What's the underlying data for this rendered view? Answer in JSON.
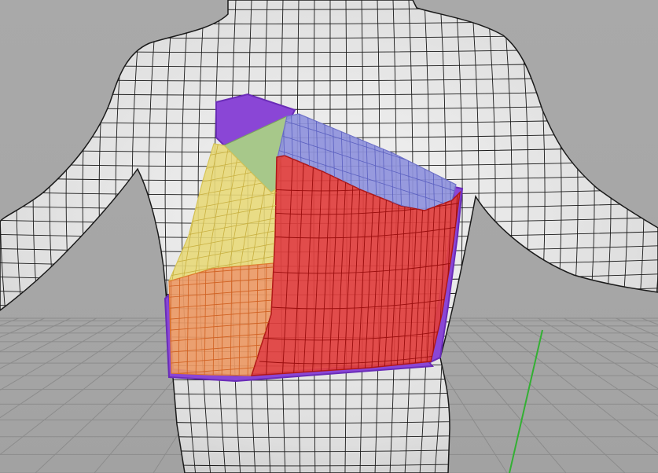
{
  "viewport": {
    "name": "Perspective",
    "display_mode": "shaded",
    "background_color": "#a7a7a7",
    "grid_color": "#8c8c8c",
    "axis_y_color": "#33b033"
  },
  "model": {
    "body": {
      "color": "#e6e6e6",
      "wire_color": "#1a1a1a"
    },
    "patches": [
      {
        "id": "purple-back",
        "color": "#8a46d6"
      },
      {
        "id": "blue-top",
        "color": "#8f92dc"
      },
      {
        "id": "green-upper-left",
        "color": "#a7c88a"
      },
      {
        "id": "yellow-left",
        "color": "#e8d97a"
      },
      {
        "id": "orange-lower-left",
        "color": "#ec9a66"
      },
      {
        "id": "red-front",
        "color": "#e0403e"
      }
    ]
  }
}
